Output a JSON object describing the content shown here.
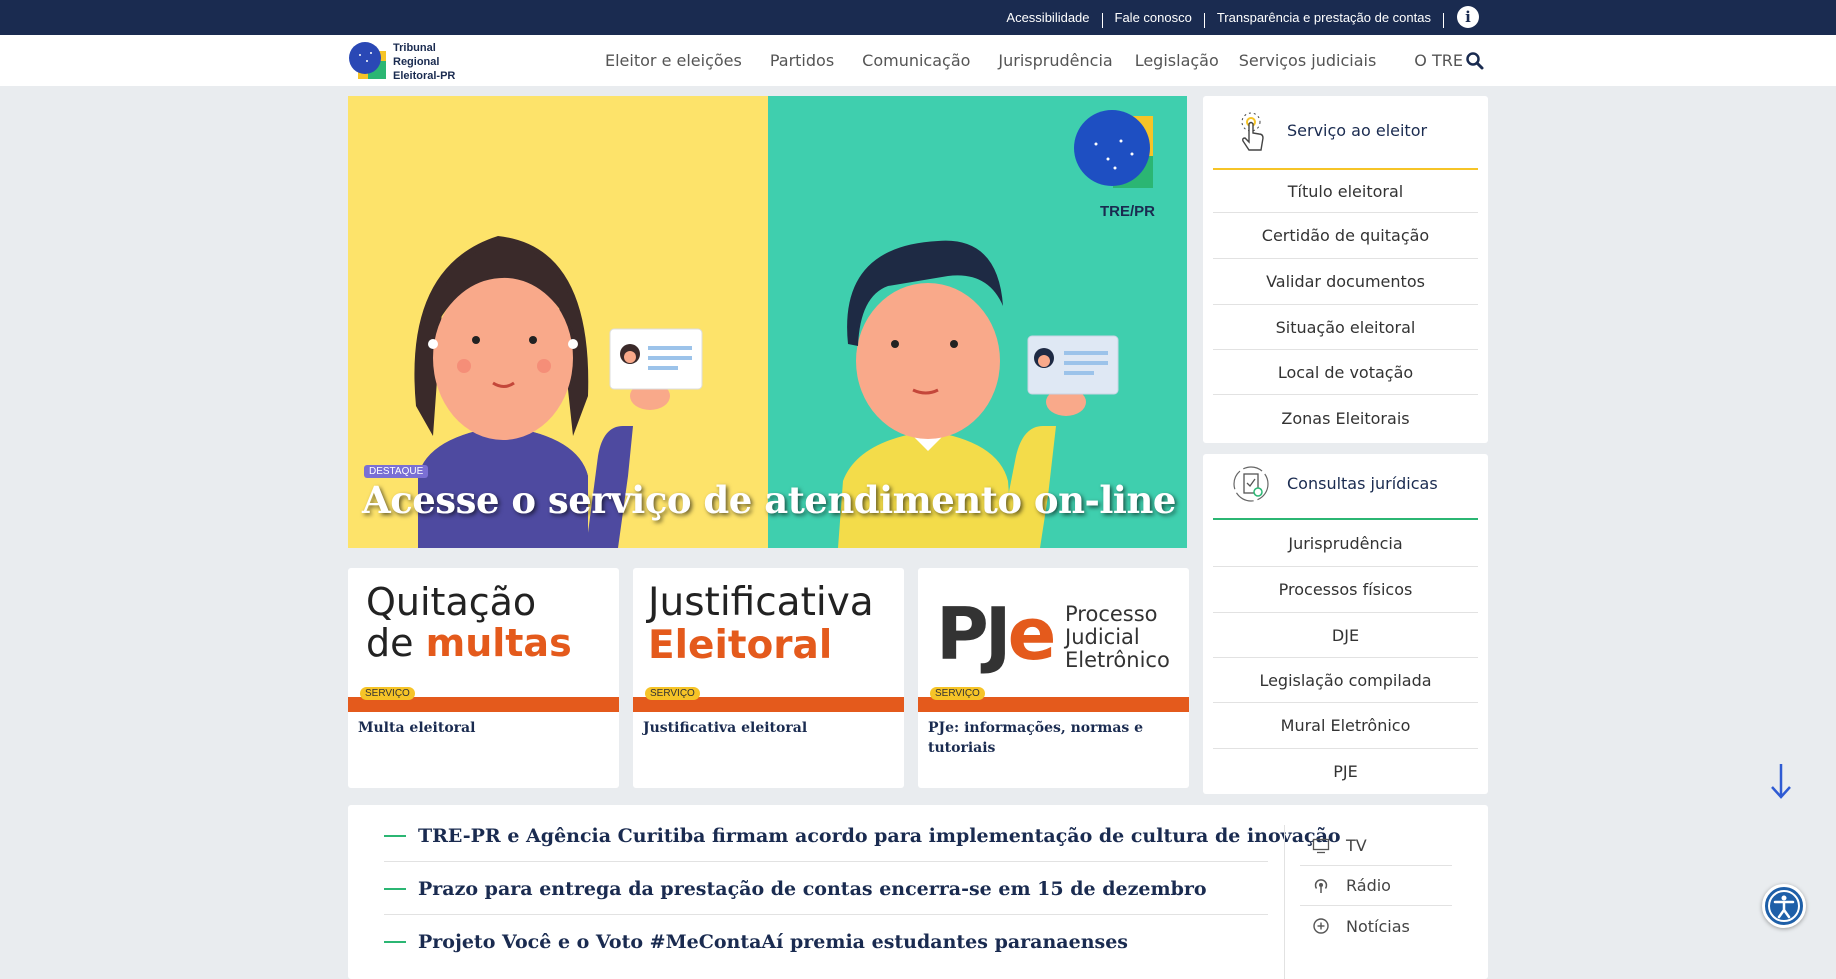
{
  "topbar": {
    "links": [
      "Acessibilidade",
      "Fale conosco",
      "Transparência e prestação de contas"
    ],
    "info_icon": "info-icon"
  },
  "header": {
    "logo_lines": [
      "Tribunal",
      "Regional",
      "Eleitoral-PR"
    ],
    "nav": [
      "Eleitor e eleições",
      "Partidos",
      "Comunicação",
      "Jurisprudência",
      "Legislação",
      "Serviços judiciais",
      "O TRE"
    ],
    "search_icon": "search-icon"
  },
  "hero": {
    "badge": "DESTAQUE",
    "title": "Acesse o serviço de atendimento on-line",
    "logo_text": "TRE/PR",
    "colors": {
      "left": "#fde36a",
      "right": "#3fcfae"
    }
  },
  "cards": [
    {
      "line1": "Quitação",
      "line2_prefix": "de ",
      "line2_highlight": "multas",
      "tag": "SERVIÇO",
      "caption": "Multa eleitoral"
    },
    {
      "line1": "Justificativa",
      "line2_highlight": "Eleitoral",
      "tag": "SERVIÇO",
      "caption": "Justificativa eleitoral"
    },
    {
      "logo_prefix": "PJ",
      "logo_highlight": "e",
      "subtitle": [
        "Processo",
        "Judicial",
        "Eletrônico"
      ],
      "tag": "SERVIÇO",
      "caption": "PJe: informações, normas e tutoriais"
    }
  ],
  "panels": {
    "servico": {
      "title": "Serviço ao eleitor",
      "accent": "#f6c427",
      "items": [
        "Título eleitoral",
        "Certidão de quitação",
        "Validar documentos",
        "Situação eleitoral",
        "Local de votação",
        "Zonas Eleitorais"
      ]
    },
    "consultas": {
      "title": "Consultas jurídicas",
      "accent": "#2bb673",
      "items": [
        "Jurisprudência",
        "Processos físicos",
        "DJE",
        "Legislação compilada",
        "Mural Eletrônico",
        "PJE"
      ]
    }
  },
  "news": {
    "headlines": [
      "TRE-PR e Agência Curitiba firmam acordo para implementação de cultura de inovação",
      "Prazo para entrega da prestação de contas encerra-se em 15 de dezembro",
      "Projeto Você e o Voto #MeContaAí premia estudantes paranaenses"
    ],
    "media": [
      {
        "label": "TV",
        "icon": "tv-icon"
      },
      {
        "label": "Rádio",
        "icon": "radio-icon"
      },
      {
        "label": "Notícias",
        "icon": "plus-circle-icon"
      }
    ]
  }
}
